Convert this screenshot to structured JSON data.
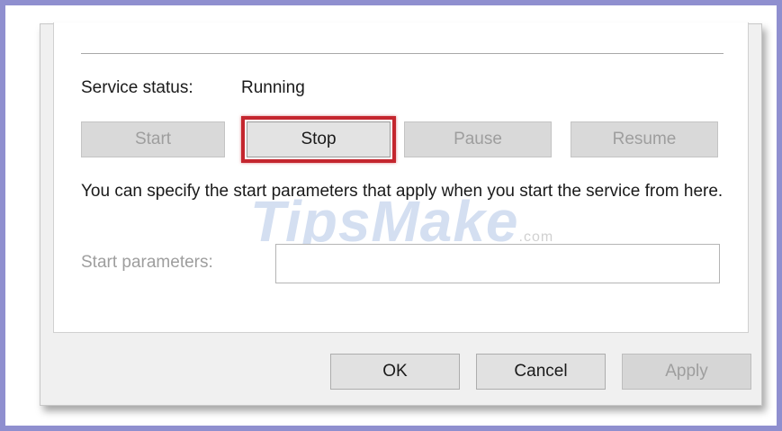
{
  "service_status": {
    "label": "Service status:",
    "value": "Running"
  },
  "controls": {
    "start": "Start",
    "stop": "Stop",
    "pause": "Pause",
    "resume": "Resume"
  },
  "description": "You can specify the start parameters that apply when you start the service from here.",
  "start_parameters": {
    "label": "Start parameters:",
    "value": ""
  },
  "footer": {
    "ok": "OK",
    "cancel": "Cancel",
    "apply": "Apply"
  },
  "watermark": {
    "text": "TipsMake",
    "suffix": ".com"
  },
  "colors": {
    "highlight": "#c4262e",
    "frame": "#8f8fcf"
  }
}
